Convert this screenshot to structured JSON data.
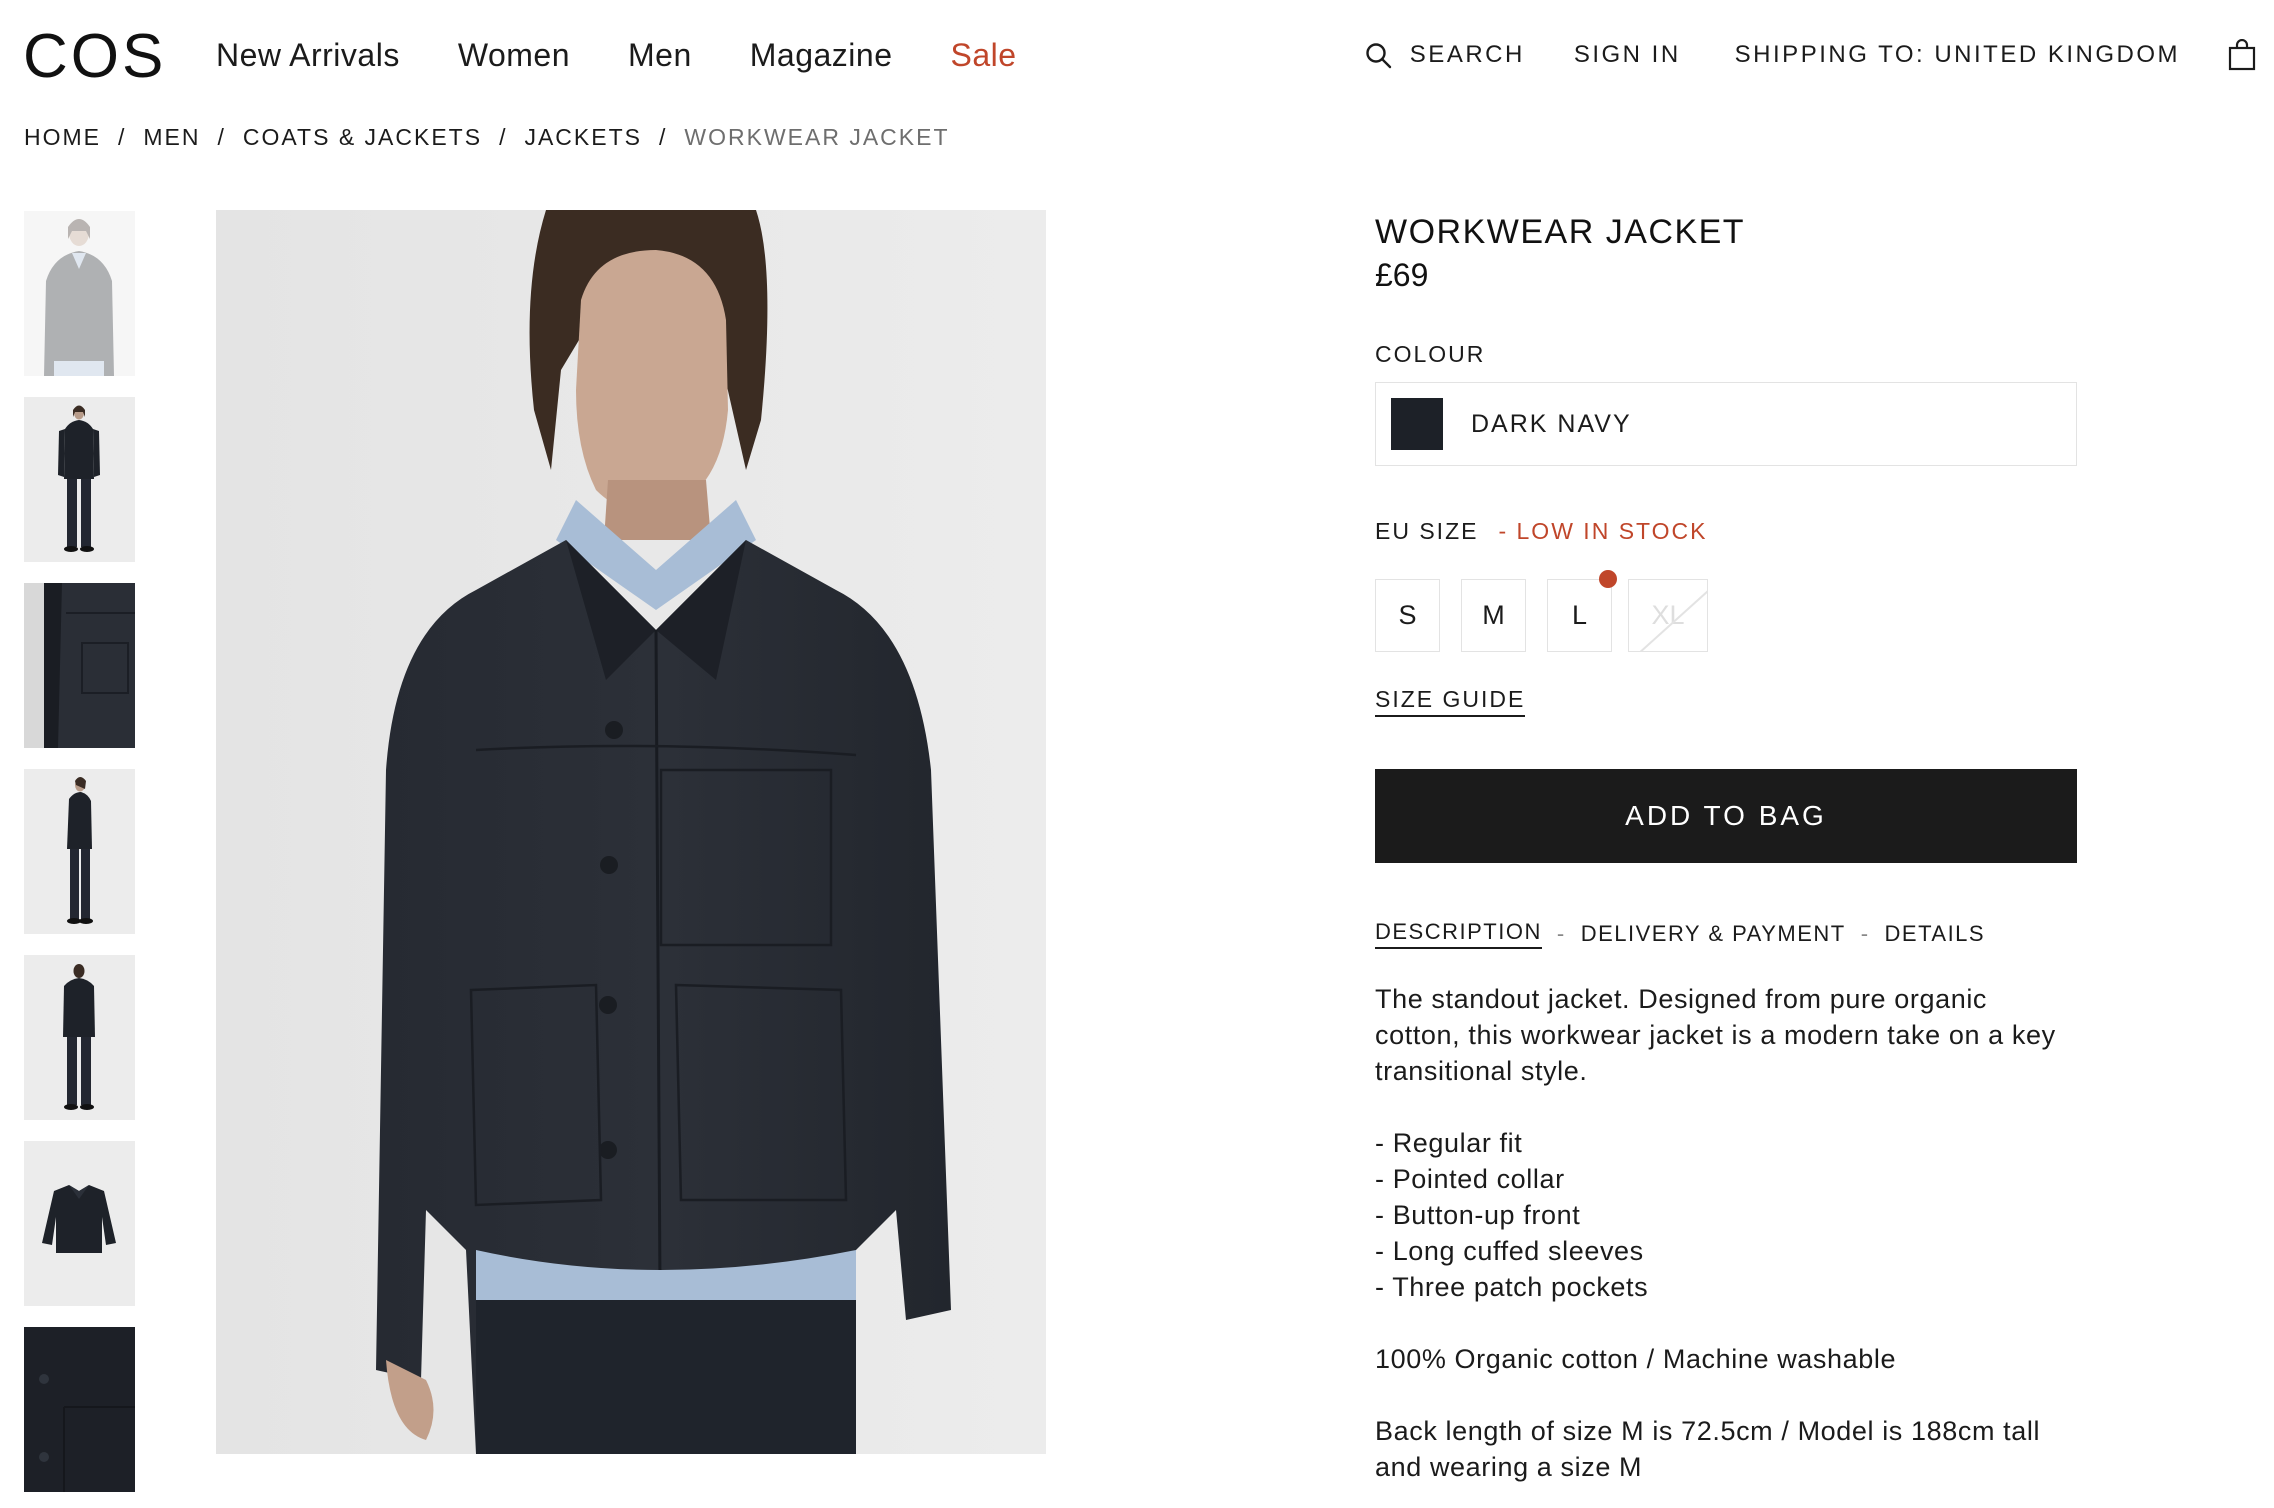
{
  "brand": {
    "logo": "COS"
  },
  "nav": {
    "items": [
      "New Arrivals",
      "Women",
      "Men",
      "Magazine",
      "Sale"
    ]
  },
  "utility": {
    "search": "SEARCH",
    "signin": "SIGN IN",
    "shipping": "SHIPPING TO: UNITED KINGDOM",
    "search_icon": "search-icon",
    "bag_icon": "shopping-bag-icon"
  },
  "breadcrumb": [
    "HOME",
    "MEN",
    "COATS & JACKETS",
    "JACKETS",
    "WORKWEAR JACKET"
  ],
  "breadcrumb_separator": "/",
  "product": {
    "title": "WORKWEAR JACKET",
    "price": "£69",
    "colour_label": "COLOUR",
    "colour_name": "DARK NAVY",
    "colour_hex": "#1d2128",
    "size_label": "EU SIZE",
    "stock_status": "- LOW IN STOCK",
    "sizes": [
      "S",
      "M",
      "L",
      "XL"
    ],
    "size_guide": "SIZE GUIDE",
    "add_to_bag": "ADD TO BAG"
  },
  "tabs": [
    "DESCRIPTION",
    "DELIVERY & PAYMENT",
    "DETAILS"
  ],
  "tab_separator": "-",
  "description": {
    "intro": "The standout jacket. Designed from pure organic cotton, this workwear jacket is a modern take on a key transitional style.",
    "features": [
      "- Regular fit",
      "- Pointed collar",
      "- Button-up front",
      "- Long cuffed sleeves",
      "- Three patch pockets"
    ],
    "composition": "100% Organic cotton / Machine washable",
    "fit_note": "Back length of size M is 72.5cm / Model is 188cm tall and wearing a size M"
  },
  "colors": {
    "accent": "#c0462a",
    "text": "#1b1b1b",
    "button_bg": "#1b1b1b",
    "border": "#e3e3e3"
  }
}
